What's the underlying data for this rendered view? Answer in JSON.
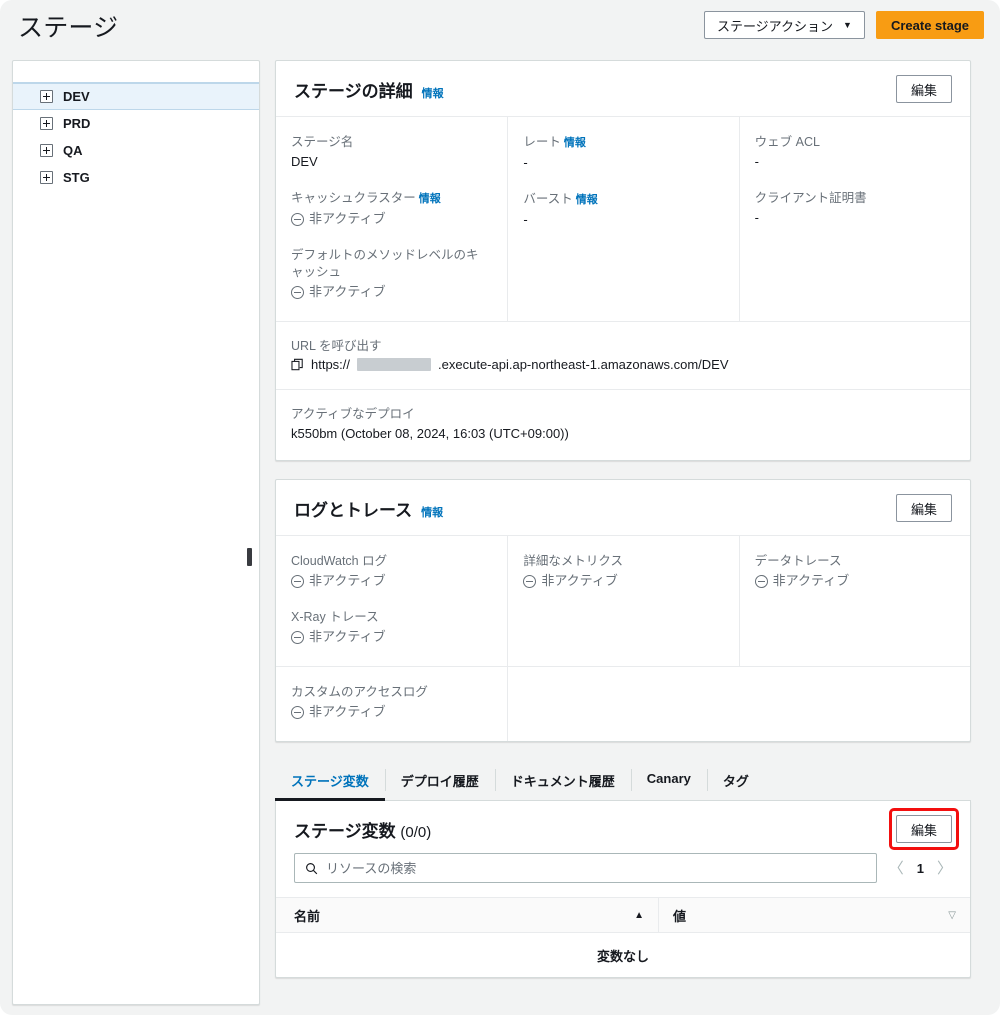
{
  "header": {
    "title": "ステージ",
    "stage_actions_label": "ステージアクション",
    "stage_actions_caret": "▼",
    "create_stage_label": "Create stage"
  },
  "sidebar": {
    "items": [
      {
        "label": "DEV",
        "selected": true
      },
      {
        "label": "PRD",
        "selected": false
      },
      {
        "label": "QA",
        "selected": false
      },
      {
        "label": "STG",
        "selected": false
      }
    ]
  },
  "stage_details": {
    "title": "ステージの詳細",
    "info_label": "情報",
    "edit_label": "編集",
    "fields": {
      "stage_name_label": "ステージ名",
      "stage_name_value": "DEV",
      "cache_cluster_label": "キャッシュクラスター",
      "cache_cluster_value": "非アクティブ",
      "default_method_cache_label": "デフォルトのメソッドレベルのキャッシュ",
      "default_method_cache_value": "非アクティブ",
      "rate_label": "レート",
      "rate_value": "-",
      "burst_label": "バースト",
      "burst_value": "-",
      "web_acl_label": "ウェブ ACL",
      "web_acl_value": "-",
      "client_cert_label": "クライアント証明書",
      "client_cert_value": "-"
    },
    "invoke_url_label": "URL を呼び出す",
    "invoke_url_prefix": "https://",
    "invoke_url_suffix": ".execute-api.ap-northeast-1.amazonaws.com/DEV",
    "active_deploy_label": "アクティブなデプロイ",
    "active_deploy_value": "k550bm (October 08, 2024, 16:03 (UTC+09:00))"
  },
  "logs_traces": {
    "title": "ログとトレース",
    "info_label": "情報",
    "edit_label": "編集",
    "cloudwatch_label": "CloudWatch ログ",
    "cloudwatch_value": "非アクティブ",
    "xray_label": "X-Ray トレース",
    "xray_value": "非アクティブ",
    "detailed_metrics_label": "詳細なメトリクス",
    "detailed_metrics_value": "非アクティブ",
    "data_trace_label": "データトレース",
    "data_trace_value": "非アクティブ",
    "custom_access_log_label": "カスタムのアクセスログ",
    "custom_access_log_value": "非アクティブ"
  },
  "tabs": [
    {
      "label": "ステージ変数",
      "active": true
    },
    {
      "label": "デプロイ履歴",
      "active": false
    },
    {
      "label": "ドキュメント履歴",
      "active": false
    },
    {
      "label": "Canary",
      "active": false
    },
    {
      "label": "タグ",
      "active": false
    }
  ],
  "stage_variables": {
    "title": "ステージ変数",
    "count": "(0/0)",
    "edit_label": "編集",
    "search_placeholder": "リソースの検索",
    "search_value": "",
    "page_number": "1",
    "prev_arrow": "〈",
    "next_arrow": "〉",
    "columns": [
      {
        "label": "名前",
        "sort": "▲"
      },
      {
        "label": "値",
        "sort": "▽"
      }
    ],
    "empty_message": "変数なし"
  },
  "colors": {
    "accent": "#0073bb",
    "brand_orange": "#f89c13",
    "highlight_red": "#f30f0f",
    "selected_row": "#e9f3fb",
    "page_bg": "#f2f3f3"
  }
}
